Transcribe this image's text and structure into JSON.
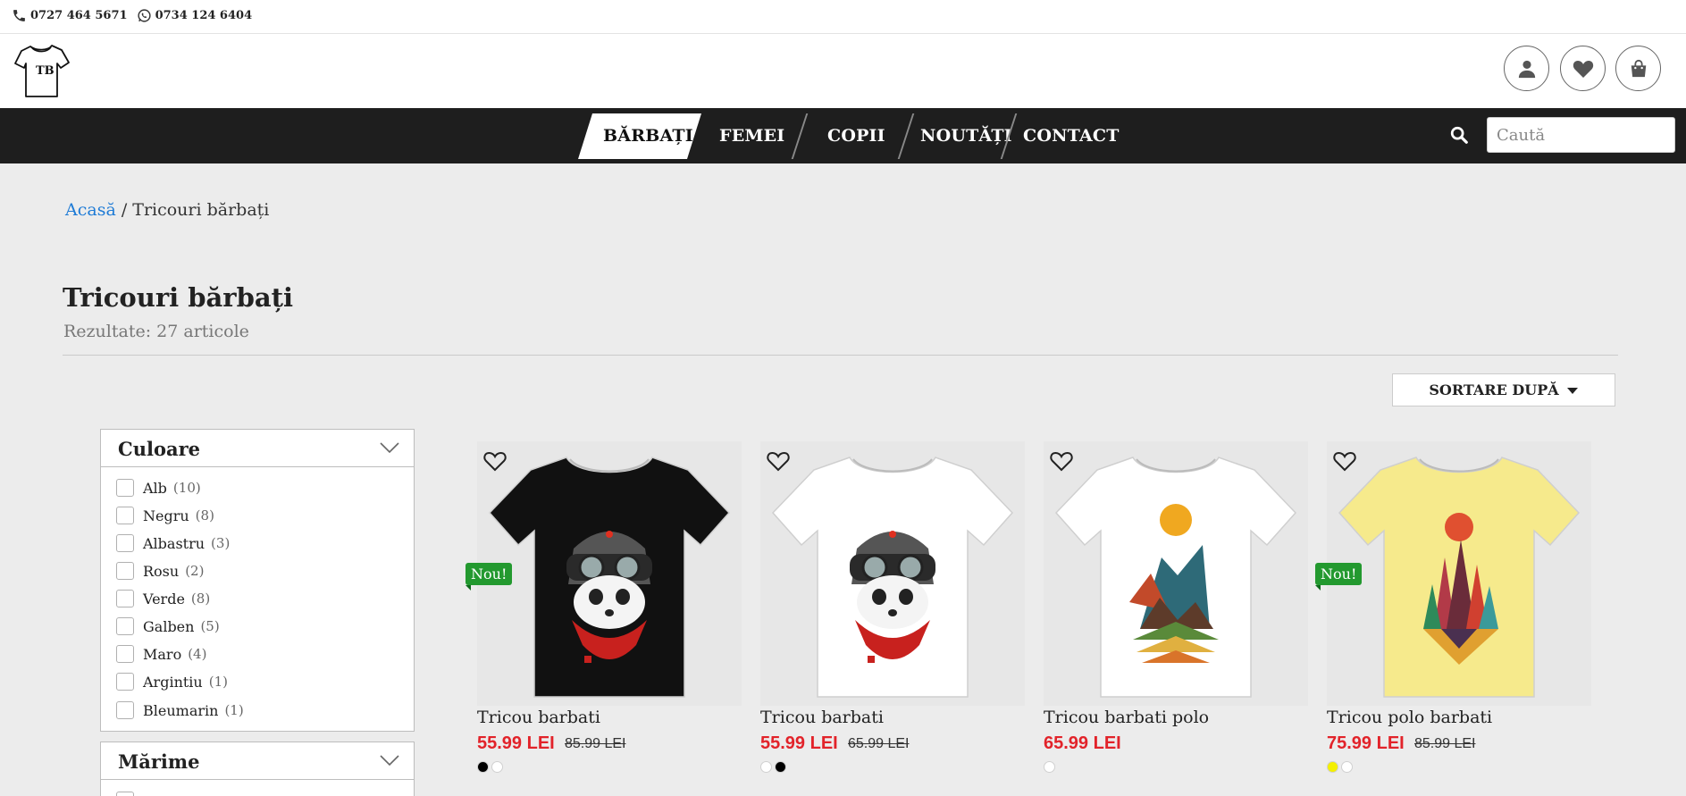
{
  "topbar": {
    "phone": "0727 464 5671",
    "whatsapp": "0734 124 6404"
  },
  "header": {
    "logo_text": "TB"
  },
  "nav": {
    "items": [
      "BĂRBAȚI",
      "FEMEI",
      "COPII",
      "NOUTĂȚI",
      "CONTACT"
    ],
    "active": "BĂRBAȚI",
    "search_placeholder": "Caută"
  },
  "breadcrumb": {
    "home": "Acasă",
    "sep": " / ",
    "current": "Tricouri bărbați"
  },
  "page": {
    "title": "Tricouri bărbați",
    "results": "Rezultate: 27 articole"
  },
  "sort": {
    "label": "SORTARE DUPĂ"
  },
  "filters": {
    "color": {
      "title": "Culoare",
      "options": [
        {
          "label": "Alb",
          "count": "(10)"
        },
        {
          "label": "Negru",
          "count": "(8)"
        },
        {
          "label": "Albastru",
          "count": "(3)"
        },
        {
          "label": "Rosu",
          "count": "(2)"
        },
        {
          "label": "Verde",
          "count": "(8)"
        },
        {
          "label": "Galben",
          "count": "(5)"
        },
        {
          "label": "Maro",
          "count": "(4)"
        },
        {
          "label": "Argintiu",
          "count": "(1)"
        },
        {
          "label": "Bleumarin",
          "count": "(1)"
        }
      ]
    },
    "size": {
      "title": "Mărime"
    }
  },
  "products": [
    {
      "name": "Tricou barbati",
      "price": "55.99 LEI",
      "old_price": "85.99 LEI",
      "badge": "Nou!",
      "shirt_color": "#111111",
      "swatches": [
        "#000000",
        "#ffffff"
      ],
      "design": "panda"
    },
    {
      "name": "Tricou barbati",
      "price": "55.99 LEI",
      "old_price": "65.99 LEI",
      "badge": "",
      "shirt_color": "#ffffff",
      "swatches": [
        "#ffffff",
        "#000000"
      ],
      "design": "panda"
    },
    {
      "name": "Tricou barbati polo",
      "price": "65.99 LEI",
      "old_price": "",
      "badge": "",
      "shirt_color": "#ffffff",
      "swatches": [
        "#ffffff"
      ],
      "design": "mountains"
    },
    {
      "name": "Tricou polo barbati",
      "price": "75.99 LEI",
      "old_price": "85.99 LEI",
      "badge": "Nou!",
      "shirt_color": "#f6ea8c",
      "swatches": [
        "#f4f000",
        "#ffffff"
      ],
      "design": "triangles"
    }
  ],
  "colors": {
    "accent": "#e2232a",
    "nav_bg": "#1e1e1e",
    "link": "#1e7bd6",
    "badge": "#23992f"
  }
}
